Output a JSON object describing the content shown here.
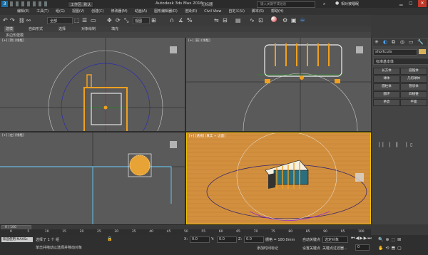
{
  "app": {
    "workspace_label": "工作区: 默认",
    "window_title": "Autodesk 3ds Max 2016",
    "file_title": "无标题",
    "search_placeholder": "键入关键字或短语",
    "user_label": "相对被睡眠"
  },
  "menu": [
    "编辑(E)",
    "工具(T)",
    "组(G)",
    "视图(V)",
    "创建(C)",
    "修改器(M)",
    "动画(A)",
    "图形编辑器(D)",
    "渲染(R)",
    "Civil View",
    "自定义(U)",
    "脚本(S)",
    "帮助(H)"
  ],
  "toolbar": {
    "selection_filter": "全部",
    "view_label": "视图"
  },
  "ribbon_tabs": [
    "建模",
    "自由形式",
    "选择",
    "对象绘制",
    "填充"
  ],
  "subribbon_label": "多边形建模",
  "viewports": {
    "top": "[+] [顶] [线框]",
    "front": "[+] [前] [线框]",
    "left": "[+] [左] [线框]",
    "perspective": "[+] [透视] [真实 + 边面]"
  },
  "command_panel": {
    "field": "shortcuts",
    "dropdown": "标准基本体",
    "buttons": [
      "长方体",
      "圆锥体",
      "球体",
      "几何球体",
      "圆柱体",
      "管状体",
      "圆环",
      "四棱锥",
      "茶壶",
      "平面"
    ]
  },
  "timeline": {
    "frame_label": "0 / 100",
    "ticks": [
      "0",
      "5",
      "10",
      "15",
      "20",
      "25",
      "30",
      "35",
      "40",
      "45",
      "50",
      "55",
      "60",
      "65",
      "70",
      "75",
      "80",
      "85",
      "90",
      "95",
      "100"
    ]
  },
  "status": {
    "left_line1": "选择了 1 个 组",
    "left_line2": "单击并拖动以选择并移动对象",
    "maxscript_label": "欢迎使用 MAXSc",
    "x": "0.0",
    "y": "0.0",
    "z": "0.0",
    "grid": "栅格 = 100.0mm",
    "autokey": "自动关键点",
    "setkey": "设置关键点",
    "selected_obj": "选定对象",
    "keyfilter": "关键点过滤器...",
    "add_time_tag": "添加时间标记",
    "frame_input": "0"
  },
  "colors": {
    "selection_orange": "#f0a020",
    "perspective_floor": "#d08a3a",
    "viewport_bg": "#5a5a5a",
    "active_border": "#f0c000"
  }
}
